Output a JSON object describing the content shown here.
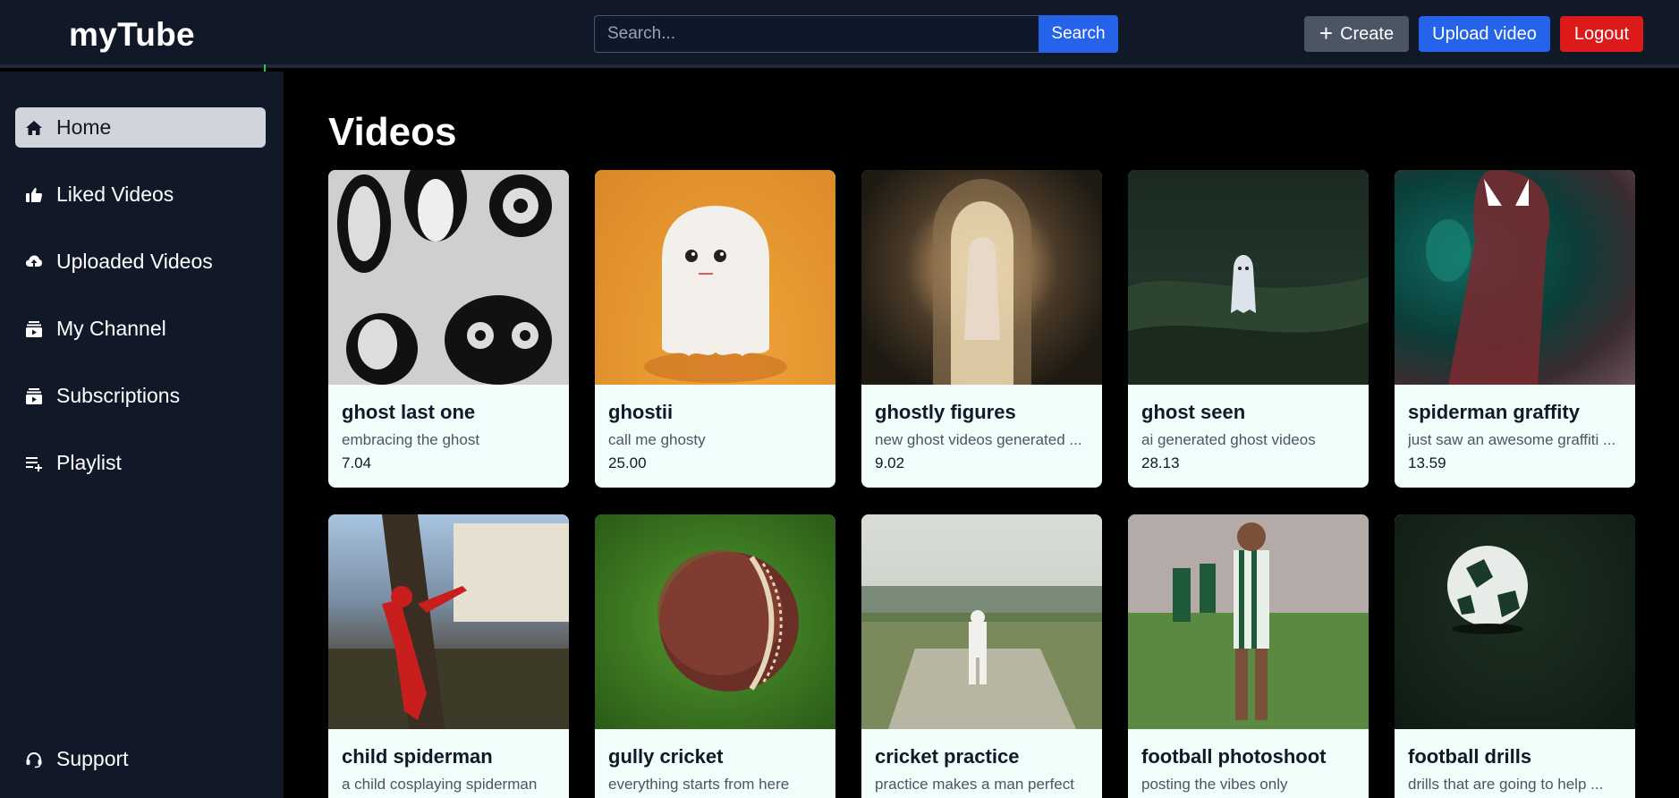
{
  "app": {
    "brand": "myTube"
  },
  "search": {
    "placeholder": "Search...",
    "button_label": "Search"
  },
  "header_actions": {
    "create_label": "Create",
    "upload_label": "Upload video",
    "logout_label": "Logout"
  },
  "sidebar": {
    "items": [
      {
        "label": "Home",
        "icon": "home-icon",
        "active": true
      },
      {
        "label": "Liked Videos",
        "icon": "thumbs-up-icon",
        "active": false
      },
      {
        "label": "Uploaded Videos",
        "icon": "cloud-upload-icon",
        "active": false
      },
      {
        "label": "My Channel",
        "icon": "channel-icon",
        "active": false
      },
      {
        "label": "Subscriptions",
        "icon": "subscriptions-icon",
        "active": false
      },
      {
        "label": "Playlist",
        "icon": "playlist-icon",
        "active": false
      }
    ],
    "support_label": "Support"
  },
  "main": {
    "title": "Videos",
    "videos": [
      {
        "title": "ghost last one",
        "description": "embracing the ghost",
        "duration": "7.04"
      },
      {
        "title": "ghostii",
        "description": "call me ghosty",
        "duration": "25.00"
      },
      {
        "title": "ghostly figures",
        "description": "new ghost videos generated ...",
        "duration": "9.02"
      },
      {
        "title": "ghost seen",
        "description": "ai generated ghost videos",
        "duration": "28.13"
      },
      {
        "title": "spiderman graffity",
        "description": "just saw an awesome graffiti ...",
        "duration": "13.59"
      },
      {
        "title": "child spiderman",
        "description": "a child cosplaying spiderman",
        "duration": ""
      },
      {
        "title": "gully cricket",
        "description": "everything starts from here",
        "duration": ""
      },
      {
        "title": "cricket practice",
        "description": "practice makes a man perfect",
        "duration": ""
      },
      {
        "title": "football photoshoot",
        "description": "posting the vibes only",
        "duration": ""
      },
      {
        "title": "football drills",
        "description": "drills that are going to help ...",
        "duration": ""
      }
    ]
  },
  "colors": {
    "topbar": "#111827",
    "sidebar": "#111827",
    "main_bg": "#000000",
    "accent_blue": "#2563eb",
    "logout_red": "#dc1a1a",
    "create_gray": "#4b5563",
    "card_bg": "#f0fdfa",
    "active_nav": "#d1d5db"
  }
}
